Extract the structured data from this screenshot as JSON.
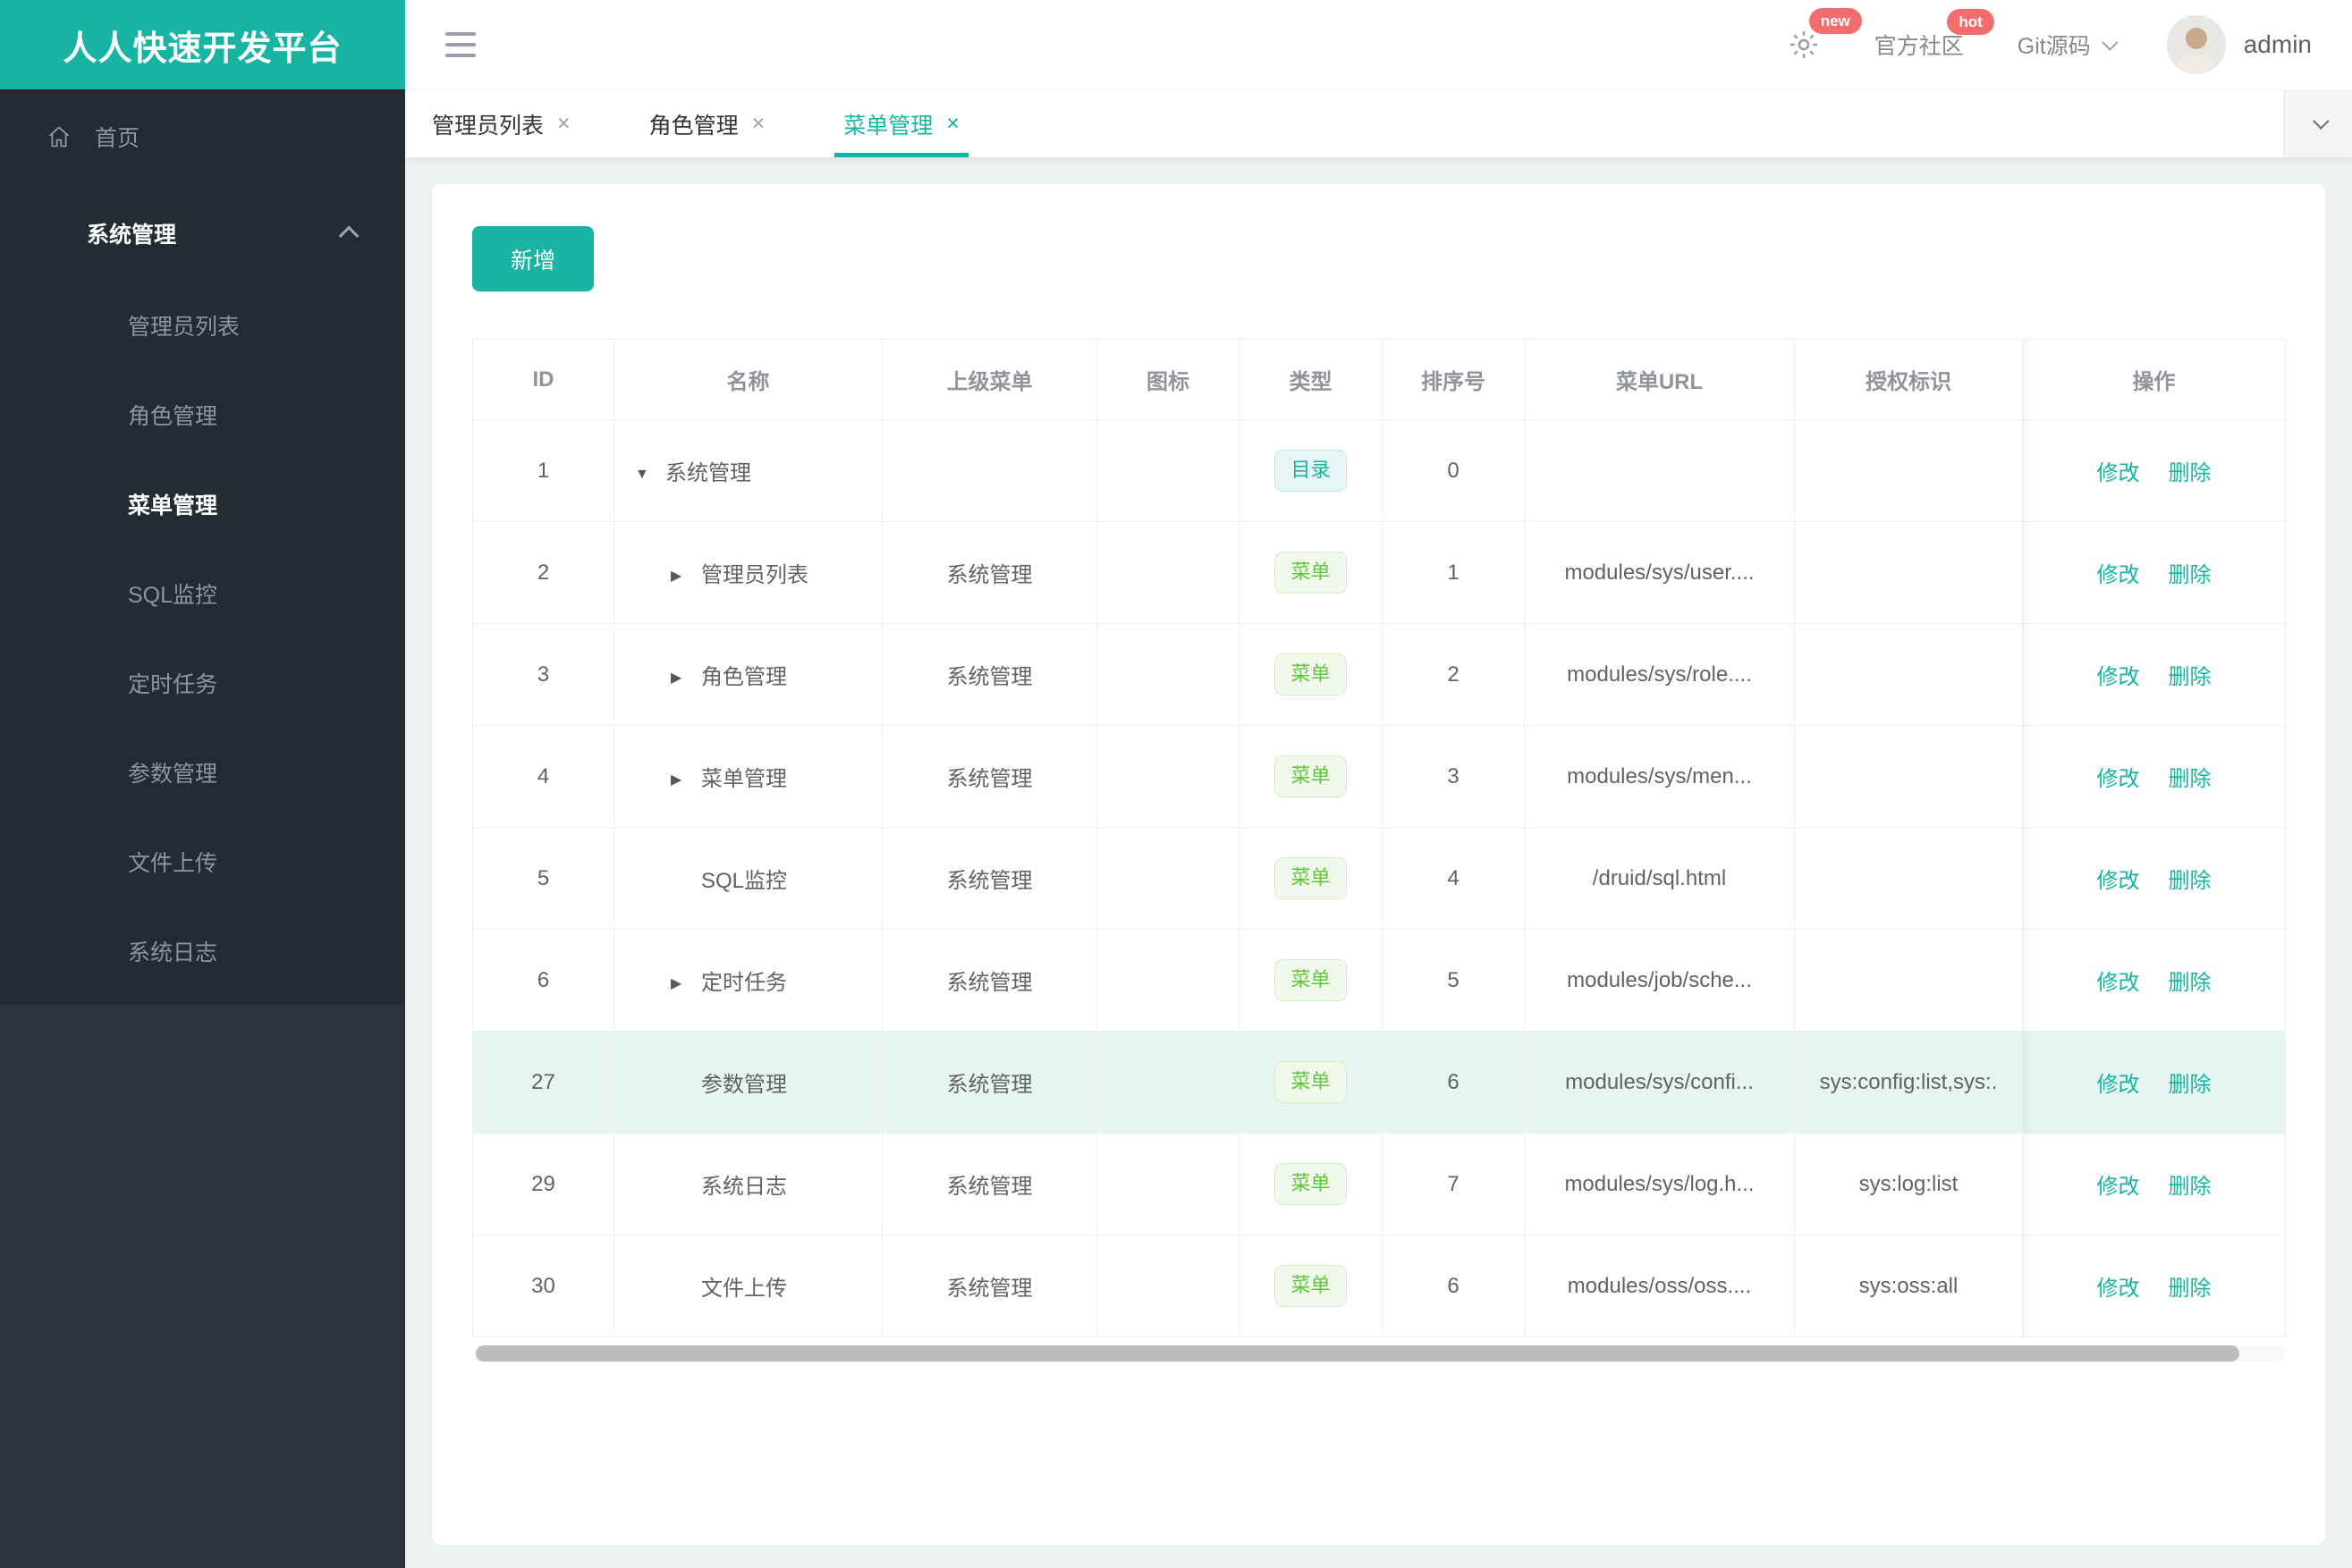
{
  "app": {
    "title": "人人快速开发平台"
  },
  "header": {
    "community_label": "官方社区",
    "git_label": "Git源码",
    "username": "admin",
    "badges": {
      "new": "new",
      "hot": "hot"
    }
  },
  "sidebar": {
    "home_label": "首页",
    "group_label": "系统管理",
    "items": [
      "管理员列表",
      "角色管理",
      "菜单管理",
      "SQL监控",
      "定时任务",
      "参数管理",
      "文件上传",
      "系统日志"
    ],
    "active_item": "菜单管理"
  },
  "tabs": [
    {
      "label": "管理员列表"
    },
    {
      "label": "角色管理"
    },
    {
      "label": "菜单管理",
      "active": true
    }
  ],
  "toolbar": {
    "add_label": "新增"
  },
  "icons": {
    "close": "×"
  },
  "table": {
    "columns": [
      "ID",
      "名称",
      "上级菜单",
      "图标",
      "类型",
      "排序号",
      "菜单URL",
      "授权标识",
      "操作"
    ],
    "actions": [
      "修改",
      "删除"
    ],
    "rows": [
      {
        "id": "1",
        "arrow": "▼",
        "name": "系统管理",
        "parent": "",
        "icon": "",
        "type": "目录",
        "order": "0",
        "url": "",
        "perms": ""
      },
      {
        "id": "2",
        "arrow": "▶",
        "name": "管理员列表",
        "parent": "系统管理",
        "icon": "",
        "type": "菜单",
        "order": "1",
        "url": "modules/sys/user....",
        "perms": ""
      },
      {
        "id": "3",
        "arrow": "▶",
        "name": "角色管理",
        "parent": "系统管理",
        "icon": "",
        "type": "菜单",
        "order": "2",
        "url": "modules/sys/role....",
        "perms": ""
      },
      {
        "id": "4",
        "arrow": "▶",
        "name": "菜单管理",
        "parent": "系统管理",
        "icon": "",
        "type": "菜单",
        "order": "3",
        "url": "modules/sys/men...",
        "perms": ""
      },
      {
        "id": "5",
        "arrow": "",
        "name": "SQL监控",
        "parent": "系统管理",
        "icon": "",
        "type": "菜单",
        "order": "4",
        "url": "/druid/sql.html",
        "perms": ""
      },
      {
        "id": "6",
        "arrow": "▶",
        "name": "定时任务",
        "parent": "系统管理",
        "icon": "",
        "type": "菜单",
        "order": "5",
        "url": "modules/job/sche...",
        "perms": ""
      },
      {
        "id": "27",
        "arrow": "",
        "name": "参数管理",
        "parent": "系统管理",
        "icon": "",
        "type": "菜单",
        "order": "6",
        "url": "modules/sys/confi...",
        "perms": "sys:config:list,sys:.",
        "highlighted": true
      },
      {
        "id": "29",
        "arrow": "",
        "name": "系统日志",
        "parent": "系统管理",
        "icon": "",
        "type": "菜单",
        "order": "7",
        "url": "modules/sys/log.h...",
        "perms": "sys:log:list"
      },
      {
        "id": "30",
        "arrow": "",
        "name": "文件上传",
        "parent": "系统管理",
        "icon": "",
        "type": "菜单",
        "order": "6",
        "url": "modules/oss/oss....",
        "perms": "sys:oss:all"
      }
    ]
  },
  "colors": {
    "brand": "#17b3a3",
    "sidebar_bg": "#2a333a",
    "sidebar_menu_bg": "#242c31",
    "badge_red": "#f56c6c",
    "tag_dir_text": "#17b3a3",
    "tag_menu_text": "#5ec73a",
    "row_highlight": "#e7f5f0",
    "table_border": "#ebeef5",
    "header_text": "#909399",
    "cell_text": "#606266"
  }
}
